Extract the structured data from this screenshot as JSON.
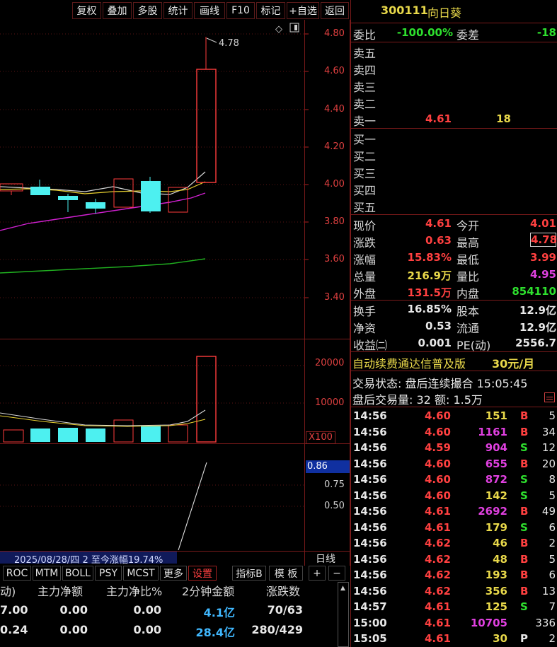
{
  "toolbar": {
    "items": [
      "复权",
      "叠加",
      "多股",
      "统计",
      "画线",
      "F10",
      "标记",
      "+自选",
      "返回"
    ]
  },
  "stock": {
    "code": "300111",
    "name": "向日葵"
  },
  "orderbook": {
    "weibi_label": "委比",
    "weibi_value": "-100.00%",
    "weicha_label": "委差",
    "weicha_value": "-18",
    "sell": [
      {
        "label": "卖五",
        "price": "",
        "vol": ""
      },
      {
        "label": "卖四",
        "price": "",
        "vol": ""
      },
      {
        "label": "卖三",
        "price": "",
        "vol": ""
      },
      {
        "label": "卖二",
        "price": "",
        "vol": ""
      },
      {
        "label": "卖一",
        "price": "4.61",
        "vol": "18"
      }
    ],
    "buy": [
      {
        "label": "买一"
      },
      {
        "label": "买二"
      },
      {
        "label": "买三"
      },
      {
        "label": "买四"
      },
      {
        "label": "买五"
      }
    ]
  },
  "quote": {
    "rows": [
      {
        "l1": "现价",
        "v1": "4.61",
        "l2": "今开",
        "v2": "4.01"
      },
      {
        "l1": "涨跌",
        "v1": "0.63",
        "l2": "最高",
        "v2": "4.78"
      },
      {
        "l1": "涨幅",
        "v1": "15.83%",
        "l2": "最低",
        "v2": "3.99"
      },
      {
        "l1": "总量",
        "v1": "216.9万",
        "l2": "量比",
        "v2": "4.95"
      },
      {
        "l1": "外盘",
        "v1": "131.5万",
        "l2": "内盘",
        "v2": "854110"
      }
    ],
    "rows2": [
      {
        "l1": "换手",
        "v1": "16.85%",
        "l2": "股本",
        "v2": "12.9亿"
      },
      {
        "l1": "净资",
        "v1": "0.53",
        "l2": "流通",
        "v2": "12.9亿"
      },
      {
        "l1": "收益㈡",
        "v1": "0.001",
        "l2": "PE(动)",
        "v2": "2556.7"
      }
    ]
  },
  "ad": {
    "text": "自动续费通达信普及版",
    "price": "30元/月"
  },
  "after_hours": {
    "status_label": "交易状态:",
    "status": "盘后连续撮合",
    "time": "15:05:45",
    "vol_label": "盘后交易量:",
    "vol": "32",
    "amt_label": "额:",
    "amt": "1.5万"
  },
  "trades": [
    {
      "t": "14:56",
      "p": "4.60",
      "v": "151",
      "s": "B",
      "n": "5"
    },
    {
      "t": "14:56",
      "p": "4.60",
      "v": "1161",
      "s": "B",
      "n": "34"
    },
    {
      "t": "14:56",
      "p": "4.59",
      "v": "904",
      "s": "S",
      "n": "12"
    },
    {
      "t": "14:56",
      "p": "4.60",
      "v": "655",
      "s": "B",
      "n": "20"
    },
    {
      "t": "14:56",
      "p": "4.60",
      "v": "872",
      "s": "S",
      "n": "8"
    },
    {
      "t": "14:56",
      "p": "4.60",
      "v": "142",
      "s": "S",
      "n": "5"
    },
    {
      "t": "14:56",
      "p": "4.61",
      "v": "2692",
      "s": "B",
      "n": "49"
    },
    {
      "t": "14:56",
      "p": "4.61",
      "v": "179",
      "s": "S",
      "n": "6"
    },
    {
      "t": "14:56",
      "p": "4.62",
      "v": "46",
      "s": "B",
      "n": "2"
    },
    {
      "t": "14:56",
      "p": "4.62",
      "v": "48",
      "s": "B",
      "n": "5"
    },
    {
      "t": "14:56",
      "p": "4.62",
      "v": "193",
      "s": "B",
      "n": "6"
    },
    {
      "t": "14:56",
      "p": "4.62",
      "v": "356",
      "s": "B",
      "n": "13"
    },
    {
      "t": "14:57",
      "p": "4.61",
      "v": "125",
      "s": "S",
      "n": "7"
    },
    {
      "t": "15:00",
      "p": "4.61",
      "v": "10705",
      "s": "",
      "n": "336"
    },
    {
      "t": "15:05",
      "p": "4.61",
      "v": "30",
      "s": "P",
      "n": "2"
    }
  ],
  "chart": {
    "price_ticks": [
      "4.80",
      "4.60",
      "4.40",
      "4.20",
      "4.00",
      "3.80",
      "3.60",
      "3.40"
    ],
    "high_label": "4.78",
    "vol_ticks": [
      "20000",
      "10000"
    ],
    "vol_unit": "X100",
    "ind_ticks": [
      "0.75",
      "0.50"
    ],
    "ind_marker": "0.86",
    "range_text": "2025/08/28/四 2 至今涨幅19.74%",
    "period": "日线"
  },
  "indicator_tabs": [
    "ROC",
    "MTM",
    "BOLL",
    "PSY",
    "MCST",
    "更多",
    "设置",
    "指标B",
    "模 板",
    "+",
    "−"
  ],
  "bottom_table": {
    "headers": [
      "动)",
      "主力净额",
      "主力净比%",
      "2分钟金额",
      "涨跌数"
    ],
    "rows": [
      [
        "7.00",
        "0.00",
        "0.00",
        "4.1亿",
        "70/63"
      ],
      [
        "0.24",
        "0.00",
        "0.00",
        "28.4亿",
        "280/429"
      ]
    ]
  },
  "colors": {
    "up": "#ff4040",
    "down": "#2ee02e",
    "grid": "#7a1a1a",
    "accent_blue": "#1030a0"
  }
}
